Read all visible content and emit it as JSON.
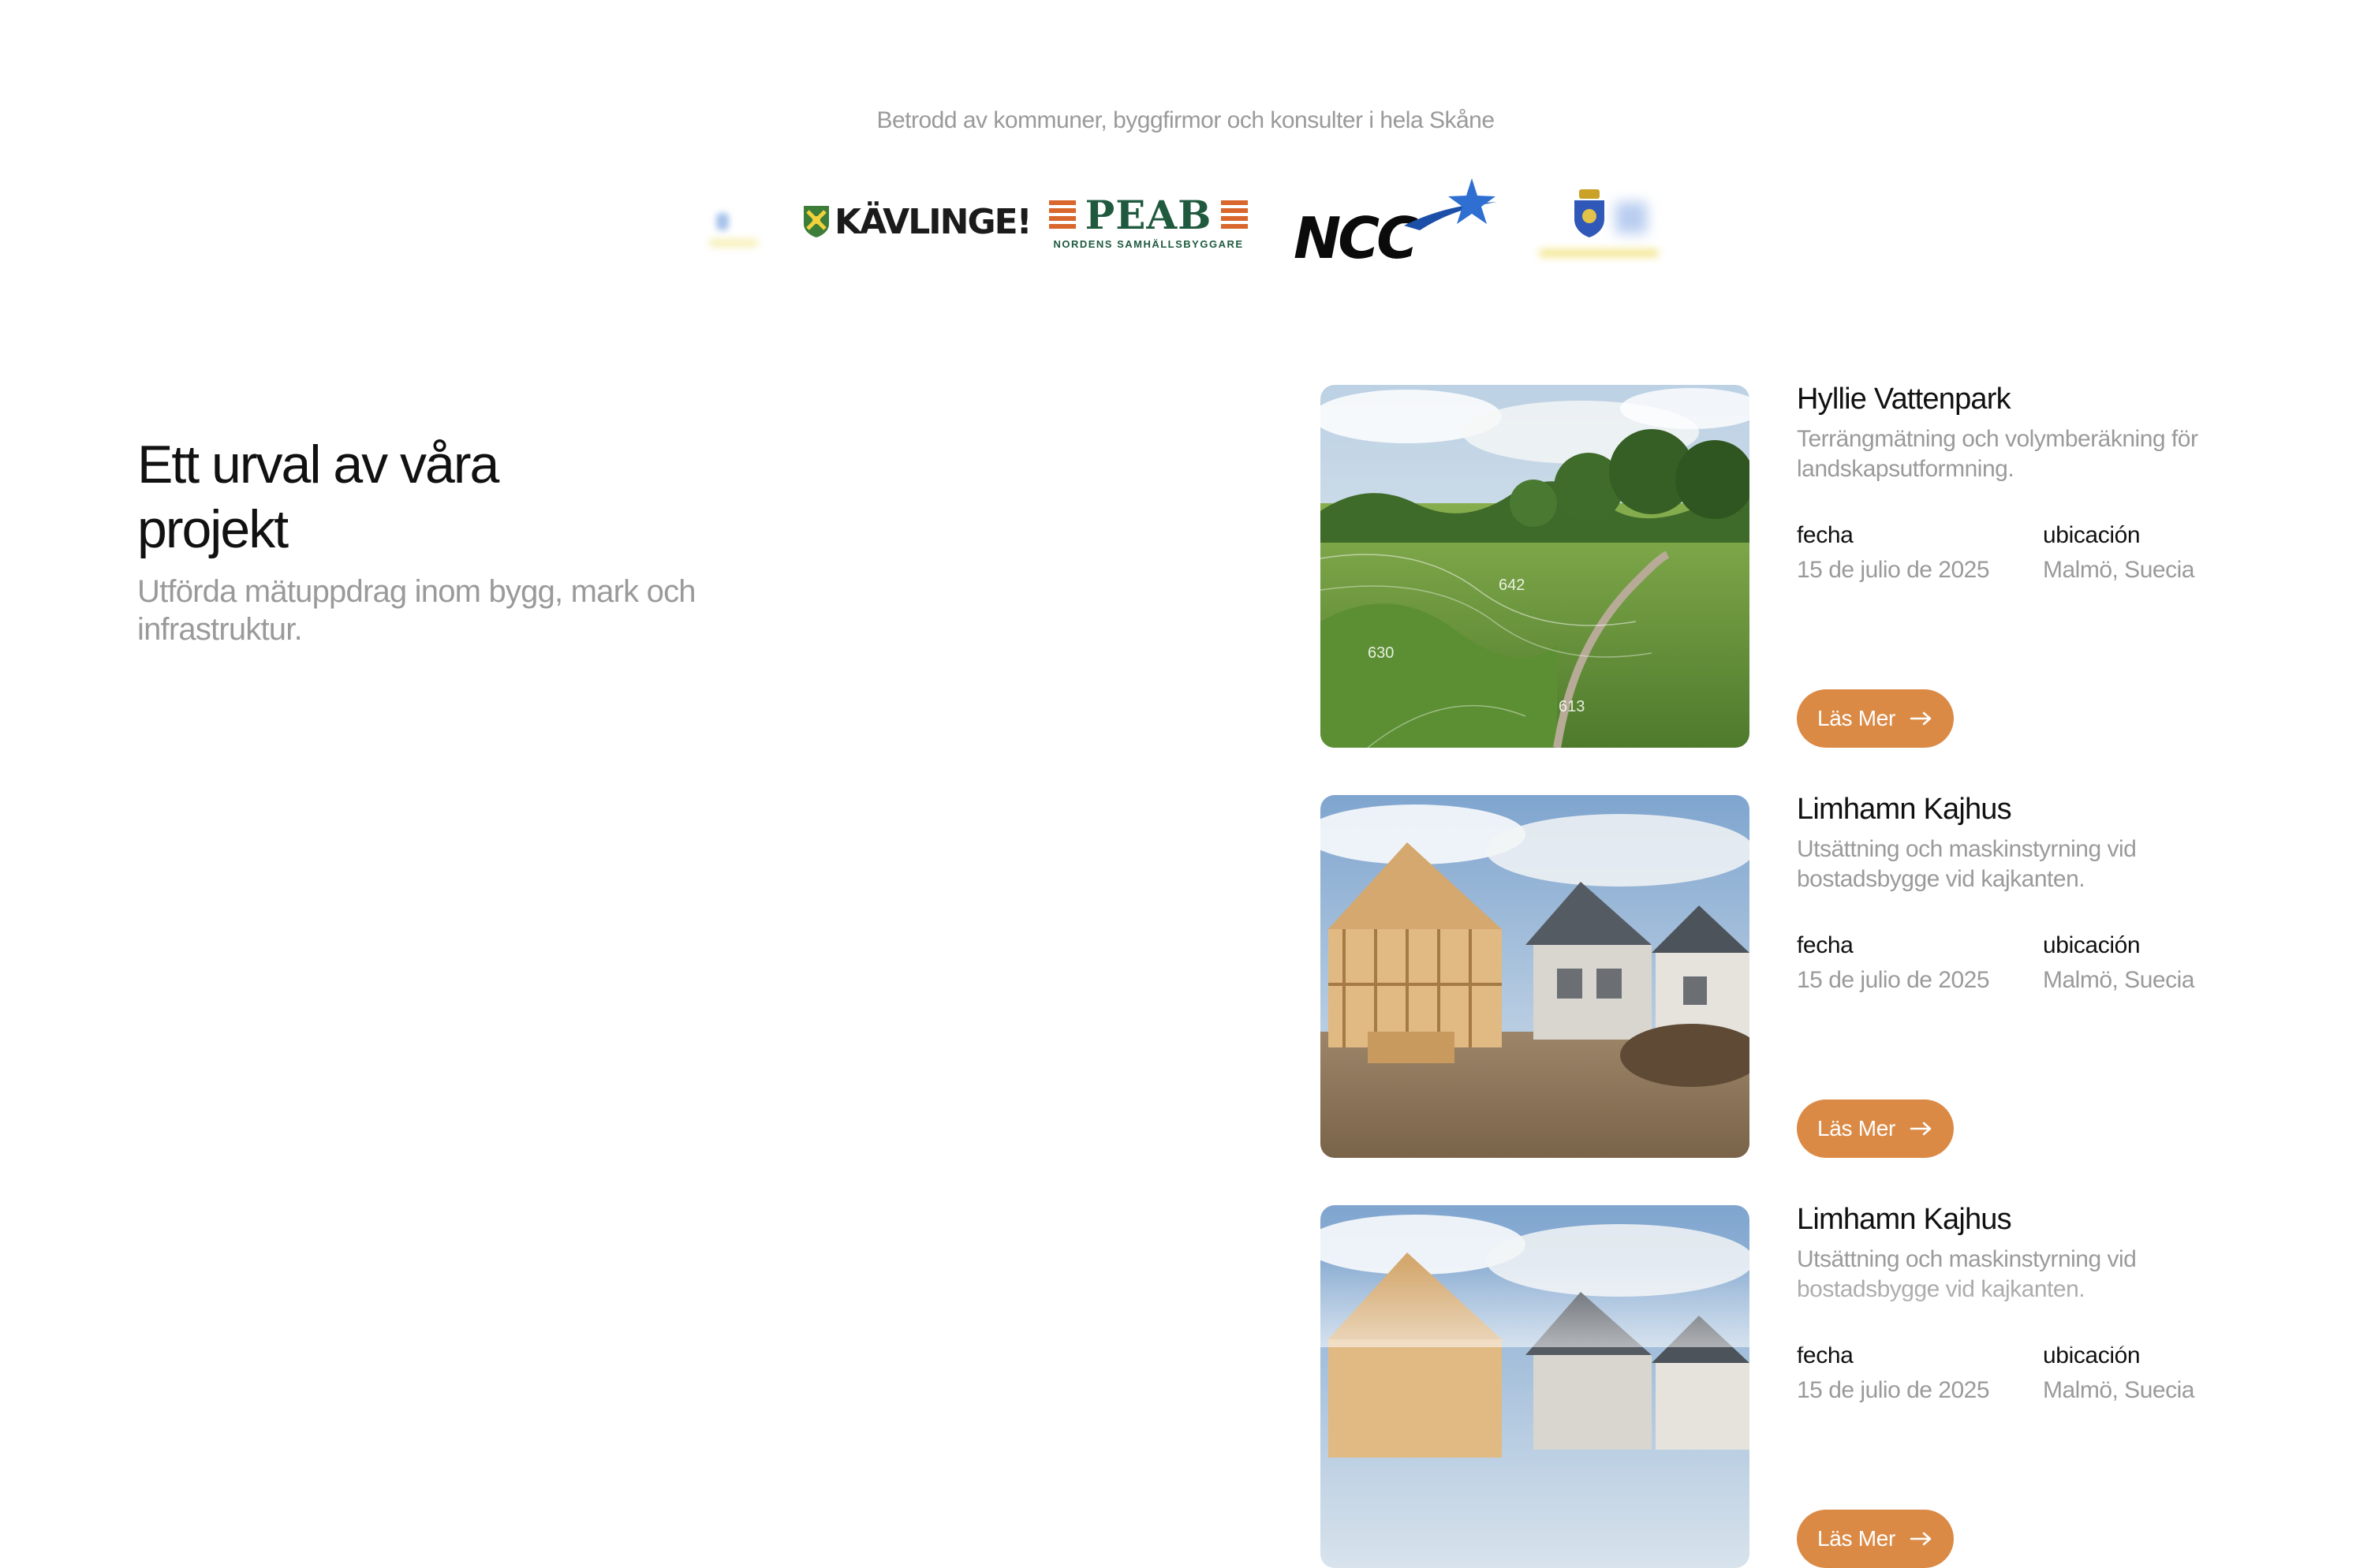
{
  "trusted": {
    "caption": "Betrodd av kommuner, byggfirmor och konsulter i hela Skåne",
    "logos": {
      "kavlinge": "KÄVLINGE!",
      "peab": "PEAB",
      "peab_sub": "NORDENS SAMHÄLLSBYGGARE",
      "ncc": "NCC"
    }
  },
  "intro": {
    "title": "Ett urval av våra projekt",
    "subtitle": "Utförda mätuppdrag inom bygg, mark och infrastruktur."
  },
  "projects": [
    {
      "title": "Hyllie Vattenpark",
      "description": "Terrängmätning och volymberäkning för landskapsutformning.",
      "date_label": "fecha",
      "date": "15 de julio de 2025",
      "location_label": "ubicación",
      "location": "Malmö, Suecia",
      "button": "Läs Mer",
      "contour_labels": [
        "642",
        "630",
        "613"
      ]
    },
    {
      "title": "Limhamn Kajhus",
      "description": "Utsättning och maskinstyrning vid bostadsbygge vid kajkanten.",
      "date_label": "fecha",
      "date": "15 de julio de 2025",
      "location_label": "ubicación",
      "location": "Malmö, Suecia",
      "button": "Läs Mer"
    },
    {
      "title": "Limhamn Kajhus",
      "description": "Utsättning och maskinstyrning vid bostadsbygge vid kajkanten.",
      "date_label": "fecha",
      "date": "15 de julio de 2025",
      "location_label": "ubicación",
      "location": "Malmö, Suecia",
      "button": "Läs Mer"
    }
  ],
  "colors": {
    "accent": "#db8a45",
    "muted_text": "#9a9a9a",
    "heading_text": "#111111",
    "peab_green": "#1f5a3f",
    "peab_orange": "#d8662d",
    "ncc_star": "#2e6fd1"
  },
  "icons": {
    "button_icon": "arrow-right-icon"
  }
}
